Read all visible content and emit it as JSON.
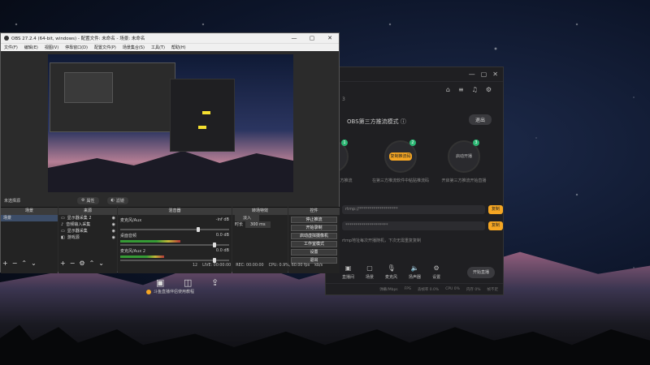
{
  "obs": {
    "title": "OBS 27.2.4 (64-bit, windows) - 配置文件: 未命名 - 场景: 未命名",
    "menu": [
      "文件(F)",
      "编辑(E)",
      "视图(V)",
      "停靠窗口(D)",
      "配置文件(P)",
      "场景集合(S)",
      "工具(T)",
      "帮助(H)"
    ],
    "no_source_selected": "未选择源",
    "properties_button": "属性",
    "filters_button": "滤镜",
    "docks": {
      "scenes": {
        "title": "场景",
        "items": [
          "场景"
        ]
      },
      "sources": {
        "title": "来源",
        "items": [
          "显示器采集 2",
          "音频输入采集",
          "显示器采集",
          "游戏源"
        ]
      },
      "mixer": {
        "title": "混音器",
        "rows": [
          {
            "name": "麦克风/Aux",
            "level": "-inf dB"
          },
          {
            "name": "桌面音频",
            "level": "0.0 dB"
          },
          {
            "name": "麦克风/Aux 2",
            "level": "0.0 dB"
          }
        ]
      },
      "transitions": {
        "title": "转场特效",
        "type": "淡入",
        "duration_label": "时长",
        "duration_value": "300 ms"
      },
      "controls": {
        "title": "控件",
        "buttons": [
          "停止推流",
          "开始录制",
          "启动虚拟摄像机",
          "工作室模式",
          "设置",
          "退出"
        ]
      }
    },
    "status": {
      "live": "LIVE: 00:00:00",
      "rec": "REC: 00:00:00",
      "cpu": "CPU: 0.9%, 60.00 fps",
      "kbps": "kb/s",
      "dropped": "12"
    },
    "tray_text": "斗鱼直播伴侣使用教程"
  },
  "app": {
    "mode_label": "OBS第三方推流模式",
    "exit_label": "退出",
    "count": "3",
    "steps": [
      {
        "num": "1",
        "label": "",
        "desc": "开启第三方推流"
      },
      {
        "num": "2",
        "label": "复制推流码",
        "desc": "在第三方推流软件中粘贴推流码"
      },
      {
        "num": "3",
        "label": "启动开播",
        "desc": "开启第三方推流开始直播"
      }
    ],
    "fields": [
      {
        "value": "rtmp://*******************",
        "copy_label": "复制"
      },
      {
        "value": "*********************",
        "copy_label": "复制"
      }
    ],
    "tip": "rtmp地址每次开播随机，下次无需重复复制",
    "tools": [
      "直播间",
      "场景",
      "麦克风",
      "扬声器",
      "设置"
    ],
    "start_label": "开始直播",
    "status": [
      "弹幕/Mbps",
      "FPS",
      "丢帧率 0.0%",
      "CPU 0%",
      "内存 0%",
      "帧不足"
    ]
  }
}
